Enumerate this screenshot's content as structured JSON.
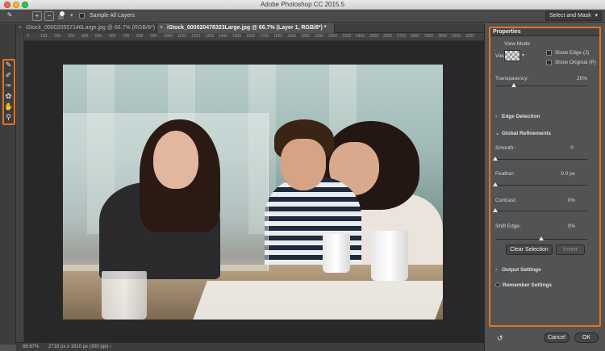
{
  "app": {
    "title": "Adobe Photoshop CC 2015.5"
  },
  "options_bar": {
    "brush_size": "20",
    "sample_all_layers": "Sample All Layers",
    "select_and_mask": "Select and Mask"
  },
  "tabs": [
    {
      "label": "iStock_000020557146Large.jpg @ 66.7% (RGB/8*)",
      "active": false
    },
    {
      "label": "iStock_000020478323Large.jpg @ 66.7% (Layer 1, RGB/8*) *",
      "active": true
    }
  ],
  "ruler": {
    "ticks": [
      "0",
      "100",
      "200",
      "300",
      "400",
      "500",
      "600",
      "700",
      "800",
      "900",
      "1000",
      "1100",
      "1200",
      "1300",
      "1400",
      "1500",
      "1600",
      "1700",
      "1800",
      "1900",
      "2000",
      "2100",
      "2200",
      "2300",
      "2400",
      "2500",
      "2600",
      "2700",
      "2800",
      "2900",
      "3000",
      "3100",
      "3200"
    ]
  },
  "toolbar": {
    "tools": [
      "quick-selection-tool",
      "refine-edge-brush-tool",
      "brush-tool",
      "lasso-tool",
      "hand-tool",
      "zoom-tool"
    ]
  },
  "status": {
    "zoom": "66.67%",
    "doc_info": "2718 px x 1810 px (300 ppi)",
    "caret": "›"
  },
  "properties": {
    "tab": "Properties",
    "view_mode": {
      "heading": "View Mode",
      "view_label": "View:",
      "show_edge": "Show Edge (J)",
      "show_original": "Show Original (P)"
    },
    "transparency": {
      "label": "Transparency:",
      "value": "20%",
      "level": 0.2
    },
    "edge_detection": "Edge Detection",
    "global_refinements": "Global Refinements",
    "smooth": {
      "label": "Smooth:",
      "value": "0",
      "level": 0.0
    },
    "feather": {
      "label": "Feather:",
      "value": "0.0 px",
      "level": 0.0
    },
    "contrast": {
      "label": "Contrast:",
      "value": "0%",
      "level": 0.0
    },
    "shift_edge": {
      "label": "Shift Edge:",
      "value": "0%",
      "level": 0.5
    },
    "clear_selection": "Clear Selection",
    "invert": "Invert",
    "output_settings": "Output Settings",
    "remember_settings": "Remember Settings",
    "cancel": "Cancel",
    "ok": "OK"
  },
  "colors": {
    "highlight": "#e8711c",
    "panel": "#535353",
    "canvas_bg": "#282828"
  }
}
